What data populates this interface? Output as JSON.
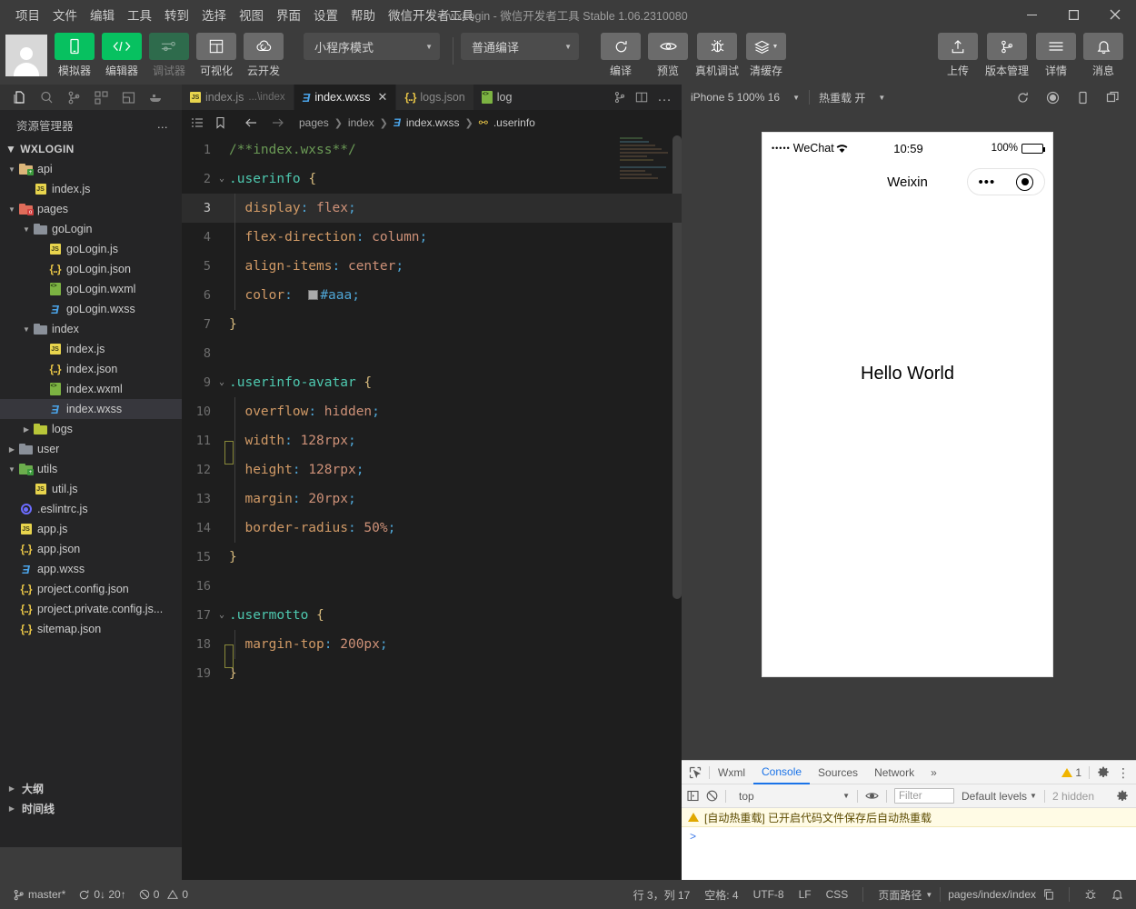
{
  "titlebar": {
    "menu": [
      "项目",
      "文件",
      "编辑",
      "工具",
      "转到",
      "选择",
      "视图",
      "界面",
      "设置",
      "帮助",
      "微信开发者工具"
    ],
    "window_title": "wxLogin - 微信开发者工具 Stable 1.06.2310080",
    "minimize": "minimize-icon",
    "maximize": "maximize-icon",
    "close": "close-icon"
  },
  "toolbar": {
    "left_items": [
      {
        "label": "模拟器",
        "icon": "phone-icon",
        "style": "green",
        "enabled": true
      },
      {
        "label": "编辑器",
        "icon": "code-icon",
        "style": "green",
        "enabled": true
      },
      {
        "label": "调试器",
        "icon": "debug-sliders-icon",
        "style": "greendim",
        "enabled": false
      },
      {
        "label": "可视化",
        "icon": "layout-icon",
        "style": "grey",
        "enabled": true
      },
      {
        "label": "云开发",
        "icon": "cloud-icon",
        "style": "grey",
        "enabled": true
      }
    ],
    "mode_select": "小程序模式",
    "compile_select": "普通编译",
    "mid_items": [
      {
        "label": "编译",
        "icon": "refresh-icon"
      },
      {
        "label": "预览",
        "icon": "eye-icon"
      },
      {
        "label": "真机调试",
        "icon": "bug-icon"
      },
      {
        "label": "清缓存",
        "icon": "layers-icon",
        "caret": true
      }
    ],
    "right_items": [
      {
        "label": "上传",
        "icon": "upload-icon"
      },
      {
        "label": "版本管理",
        "icon": "branch-icon"
      },
      {
        "label": "详情",
        "icon": "menu-lines-icon"
      },
      {
        "label": "消息",
        "icon": "bell-icon"
      }
    ]
  },
  "activity_bar": {
    "icons": [
      "files-icon",
      "search-icon",
      "source-control-icon",
      "extensions-icon",
      "wxml-panel-icon",
      "docker-icon"
    ],
    "active_index": 0
  },
  "tabs": {
    "items": [
      {
        "label": "index.js",
        "sub": "...\\index",
        "icon": "js-icon",
        "active": false,
        "closable": false
      },
      {
        "label": "index.wxss",
        "sub": "",
        "icon": "wxss-icon",
        "active": true,
        "closable": true
      },
      {
        "label": "logs.json",
        "sub": "",
        "icon": "json-icon",
        "active": false,
        "closable": false
      }
    ],
    "extra_label": "log",
    "extra_icon": "wxml-green-icon",
    "tools": [
      "source-control-small-icon",
      "split-editor-icon",
      "more-actions-icon"
    ]
  },
  "simulator_bar": {
    "device": "iPhone 5 100% 16",
    "hot_reload": "热重载 开",
    "icons": [
      "refresh-icon",
      "record-icon",
      "rotate-icon",
      "window-icon"
    ]
  },
  "sidebar": {
    "title": "资源管理器",
    "more": "…",
    "root": "WXLOGIN",
    "tree": [
      {
        "depth": 1,
        "label": "api",
        "type": "folder",
        "color": "yellow",
        "expanded": true,
        "badge": "+"
      },
      {
        "depth": 2,
        "label": "index.js",
        "type": "js"
      },
      {
        "depth": 1,
        "label": "pages",
        "type": "folder",
        "color": "red",
        "expanded": true,
        "badge": "o"
      },
      {
        "depth": 2,
        "label": "goLogin",
        "type": "folder",
        "color": "grey",
        "expanded": true
      },
      {
        "depth": 3,
        "label": "goLogin.js",
        "type": "js"
      },
      {
        "depth": 3,
        "label": "goLogin.json",
        "type": "json"
      },
      {
        "depth": 3,
        "label": "goLogin.wxml",
        "type": "wxml"
      },
      {
        "depth": 3,
        "label": "goLogin.wxss",
        "type": "wxss"
      },
      {
        "depth": 2,
        "label": "index",
        "type": "folder",
        "color": "grey",
        "expanded": true
      },
      {
        "depth": 3,
        "label": "index.js",
        "type": "js"
      },
      {
        "depth": 3,
        "label": "index.json",
        "type": "json"
      },
      {
        "depth": 3,
        "label": "index.wxml",
        "type": "wxml"
      },
      {
        "depth": 3,
        "label": "index.wxss",
        "type": "wxss",
        "selected": true
      },
      {
        "depth": 2,
        "label": "logs",
        "type": "folder",
        "color": "lime",
        "expanded": false
      },
      {
        "depth": 1,
        "label": "user",
        "type": "folder",
        "color": "grey",
        "expanded": false
      },
      {
        "depth": 1,
        "label": "utils",
        "type": "folder",
        "color": "green",
        "expanded": true,
        "badge": "+"
      },
      {
        "depth": 2,
        "label": "util.js",
        "type": "js"
      },
      {
        "depth": 1,
        "label": ".eslintrc.js",
        "type": "eslint"
      },
      {
        "depth": 1,
        "label": "app.js",
        "type": "js"
      },
      {
        "depth": 1,
        "label": "app.json",
        "type": "json"
      },
      {
        "depth": 1,
        "label": "app.wxss",
        "type": "wxss"
      },
      {
        "depth": 1,
        "label": "project.config.json",
        "type": "json"
      },
      {
        "depth": 1,
        "label": "project.private.config.js...",
        "type": "json"
      },
      {
        "depth": 1,
        "label": "sitemap.json",
        "type": "json"
      }
    ],
    "bottom_sections": [
      "大纲",
      "时间线"
    ]
  },
  "breadcrumb": {
    "icons": [
      "outline-icon",
      "bookmark-icon",
      "back-arrow-icon",
      "forward-arrow-icon"
    ],
    "parts": [
      "pages",
      "index",
      "index.wxss",
      ".userinfo"
    ]
  },
  "editor": {
    "language": "CSS",
    "cursor_line": 3,
    "lines": [
      {
        "n": 1,
        "fold": "",
        "tokens": [
          {
            "t": "/**index.wxss**/",
            "c": "comment"
          }
        ]
      },
      {
        "n": 2,
        "fold": "v",
        "tokens": [
          {
            "t": ".userinfo",
            "c": "sel"
          },
          {
            "t": " ",
            "c": "plain"
          },
          {
            "t": "{",
            "c": "brace"
          }
        ]
      },
      {
        "n": 3,
        "fold": "",
        "highlight": true,
        "tokens": [
          {
            "t": "  display",
            "c": "prop"
          },
          {
            "t": ": ",
            "c": "punc"
          },
          {
            "t": "flex",
            "c": "val"
          },
          {
            "t": ";",
            "c": "punc"
          }
        ]
      },
      {
        "n": 4,
        "fold": "",
        "tokens": [
          {
            "t": "  flex-direction",
            "c": "prop"
          },
          {
            "t": ": ",
            "c": "punc"
          },
          {
            "t": "column",
            "c": "val"
          },
          {
            "t": ";",
            "c": "punc"
          }
        ]
      },
      {
        "n": 5,
        "fold": "",
        "tokens": [
          {
            "t": "  align-items",
            "c": "prop"
          },
          {
            "t": ": ",
            "c": "punc"
          },
          {
            "t": "center",
            "c": "val"
          },
          {
            "t": ";",
            "c": "punc"
          }
        ]
      },
      {
        "n": 6,
        "fold": "",
        "swatch": "#aaaaaa",
        "tokens": [
          {
            "t": "  color",
            "c": "prop"
          },
          {
            "t": ":  ",
            "c": "punc"
          },
          {
            "t": "SWATCH",
            "c": "swatch"
          },
          {
            "t": "#aaa",
            "c": "punc"
          },
          {
            "t": ";",
            "c": "punc"
          }
        ]
      },
      {
        "n": 7,
        "fold": "",
        "tokens": [
          {
            "t": "}",
            "c": "brace"
          }
        ]
      },
      {
        "n": 8,
        "fold": "",
        "tokens": []
      },
      {
        "n": 9,
        "fold": "v",
        "tokens": [
          {
            "t": ".userinfo-avatar",
            "c": "sel"
          },
          {
            "t": " ",
            "c": "plain"
          },
          {
            "t": "{",
            "c": "brace"
          }
        ]
      },
      {
        "n": 10,
        "fold": "",
        "tokens": [
          {
            "t": "  overflow",
            "c": "prop"
          },
          {
            "t": ": ",
            "c": "punc"
          },
          {
            "t": "hidden",
            "c": "val"
          },
          {
            "t": ";",
            "c": "punc"
          }
        ]
      },
      {
        "n": 11,
        "fold": "",
        "tokens": [
          {
            "t": "  width",
            "c": "prop"
          },
          {
            "t": ": ",
            "c": "punc"
          },
          {
            "t": "128rpx",
            "c": "num"
          },
          {
            "t": ";",
            "c": "punc"
          }
        ]
      },
      {
        "n": 12,
        "fold": "",
        "tokens": [
          {
            "t": "  height",
            "c": "prop"
          },
          {
            "t": ": ",
            "c": "punc"
          },
          {
            "t": "128rpx",
            "c": "num"
          },
          {
            "t": ";",
            "c": "punc"
          }
        ]
      },
      {
        "n": 13,
        "fold": "",
        "tokens": [
          {
            "t": "  margin",
            "c": "prop"
          },
          {
            "t": ": ",
            "c": "punc"
          },
          {
            "t": "20rpx",
            "c": "num"
          },
          {
            "t": ";",
            "c": "punc"
          }
        ]
      },
      {
        "n": 14,
        "fold": "",
        "tokens": [
          {
            "t": "  border-radius",
            "c": "prop"
          },
          {
            "t": ": ",
            "c": "punc"
          },
          {
            "t": "50%",
            "c": "num"
          },
          {
            "t": ";",
            "c": "punc"
          }
        ]
      },
      {
        "n": 15,
        "fold": "",
        "tokens": [
          {
            "t": "}",
            "c": "brace"
          }
        ]
      },
      {
        "n": 16,
        "fold": "",
        "tokens": []
      },
      {
        "n": 17,
        "fold": "v",
        "tokens": [
          {
            "t": ".usermotto",
            "c": "sel"
          },
          {
            "t": " ",
            "c": "plain"
          },
          {
            "t": "{",
            "c": "brace"
          }
        ]
      },
      {
        "n": 18,
        "fold": "",
        "tokens": [
          {
            "t": "  margin-top",
            "c": "prop"
          },
          {
            "t": ": ",
            "c": "punc"
          },
          {
            "t": "200px",
            "c": "num"
          },
          {
            "t": ";",
            "c": "punc"
          }
        ]
      },
      {
        "n": 19,
        "fold": "",
        "tokens": [
          {
            "t": "}",
            "c": "brace"
          }
        ]
      }
    ],
    "colors": {
      "comment": "#6a9955",
      "selector": "#4ec9b0",
      "brace": "#d7ba7d",
      "property": "#d19a66",
      "value": "#ce9178",
      "punctuation": "#4fa6d6",
      "background": "#1e1e1e"
    }
  },
  "simulator": {
    "status_bar": {
      "signal_dots": "•••••",
      "carrier": "WeChat",
      "wifi": "wifi-icon",
      "time": "10:59",
      "battery_percent": "100%"
    },
    "nav_title": "Weixin",
    "capsule": {
      "dots": "•••",
      "target": "target-icon"
    },
    "page_text": "Hello World"
  },
  "devtools": {
    "inspect_icon": "inspect-element-icon",
    "tabs": [
      "Wxml",
      "Console",
      "Sources",
      "Network"
    ],
    "active_tab": "Console",
    "overflow": "»",
    "warning_count": "1",
    "settings_icon": "gear-icon",
    "more_icon": "kebab-menu-icon",
    "filters": {
      "sidebar_icon": "console-sidebar-icon",
      "clear_icon": "clear-console-icon",
      "context": "top",
      "eye_icon": "live-expression-icon",
      "filter_placeholder": "Filter",
      "levels": "Default levels",
      "hidden": "2 hidden",
      "settings_icon": "console-settings-icon"
    },
    "messages": [
      {
        "type": "warning",
        "text": "[自动热重载] 已开启代码文件保存后自动热重载"
      }
    ],
    "prompt": ">"
  },
  "statusbar": {
    "branch": "master*",
    "sync": "0↓ 20↑",
    "errors": "0",
    "warnings": "0",
    "position": "行 3，列 17",
    "indent": "空格: 4",
    "encoding": "UTF-8",
    "eol": "LF",
    "language": "CSS",
    "page_path_label": "页面路径",
    "page_path": "pages/index/index",
    "copy_icon": "copy-icon",
    "right_icons": [
      "bug-small-icon",
      "bell-small-icon"
    ]
  }
}
